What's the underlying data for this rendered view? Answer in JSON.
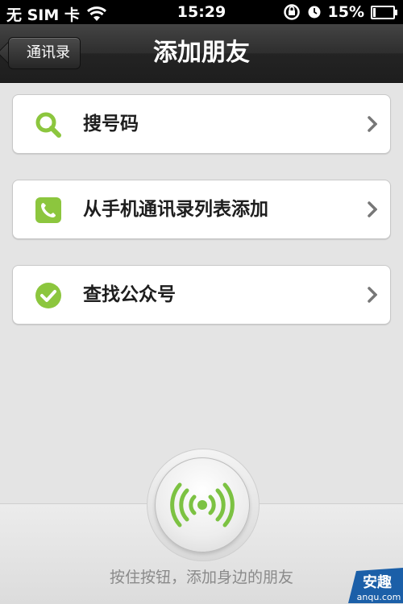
{
  "status_bar": {
    "carrier": "无 SIM 卡",
    "time": "15:29",
    "battery_percent": "15%",
    "icons": [
      "wifi-icon",
      "orientation-lock-icon",
      "alarm-icon",
      "battery-icon"
    ]
  },
  "nav": {
    "back_label": "通讯录",
    "title": "添加朋友"
  },
  "items": [
    {
      "label": "搜号码",
      "icon": "search-icon"
    },
    {
      "label": "从手机通讯录列表添加",
      "icon": "phone-contacts-icon"
    },
    {
      "label": "查找公众号",
      "icon": "checkmark-icon"
    }
  ],
  "radar": {
    "icon": "radar-signal-icon",
    "hint": "按住按钮，添加身边的朋友"
  },
  "watermark": {
    "title": "安趣",
    "url": "anqu.com"
  },
  "colors": {
    "accent_green": "#8cc63e",
    "nav_dark": "#2a2a2a",
    "background": "#e4e4e4"
  }
}
